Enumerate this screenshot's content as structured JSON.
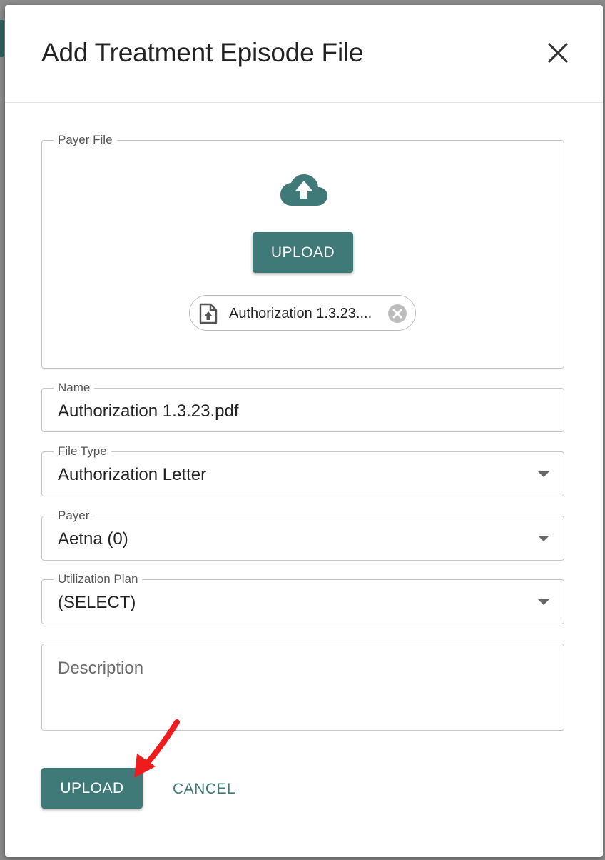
{
  "dialog": {
    "title": "Add Treatment Episode File"
  },
  "payer_file": {
    "legend": "Payer File",
    "upload_label": "UPLOAD",
    "attached_file": "Authorization 1.3.23...."
  },
  "fields": {
    "name": {
      "label": "Name",
      "value": "Authorization 1.3.23.pdf"
    },
    "file_type": {
      "label": "File Type",
      "value": "Authorization Letter"
    },
    "payer": {
      "label": "Payer",
      "value": "Aetna (0)"
    },
    "utilization_plan": {
      "label": "Utilization Plan",
      "value": "(SELECT)"
    },
    "description": {
      "placeholder": "Description"
    }
  },
  "actions": {
    "upload_label": "UPLOAD",
    "cancel_label": "CANCEL"
  },
  "colors": {
    "accent": "#3f7a78",
    "annotation_arrow": "#ee1c1c"
  },
  "icons": {
    "close": "close-icon",
    "cloud_upload": "cloud-upload-icon",
    "file_upload": "file-upload-icon",
    "remove": "remove-circle-icon",
    "dropdown": "chevron-down-icon"
  }
}
